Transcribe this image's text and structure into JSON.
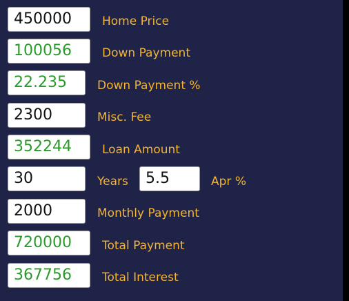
{
  "colors": {
    "background": "#1f2347",
    "label": "#f5b431",
    "input_value": "#111111",
    "computed_value": "#2a9a2a",
    "field_background": "#ffffff"
  },
  "form": {
    "home_price": {
      "value": "450000",
      "label": "Home Price"
    },
    "down_payment": {
      "value": "100056",
      "label": "Down Payment"
    },
    "down_payment_pct": {
      "value": "22.235",
      "label": "Down Payment %"
    },
    "misc_fee": {
      "value": "2300",
      "label": "Misc. Fee"
    },
    "loan_amount": {
      "value": "352244",
      "label": "Loan Amount"
    },
    "years": {
      "value": "30",
      "label": "Years"
    },
    "apr": {
      "value": "5.5",
      "label": "Apr %"
    },
    "monthly_payment": {
      "value": "2000",
      "label": "Monthly Payment"
    },
    "total_payment": {
      "value": "720000",
      "label": "Total Payment"
    },
    "total_interest": {
      "value": "367756",
      "label": "Total Interest"
    }
  }
}
